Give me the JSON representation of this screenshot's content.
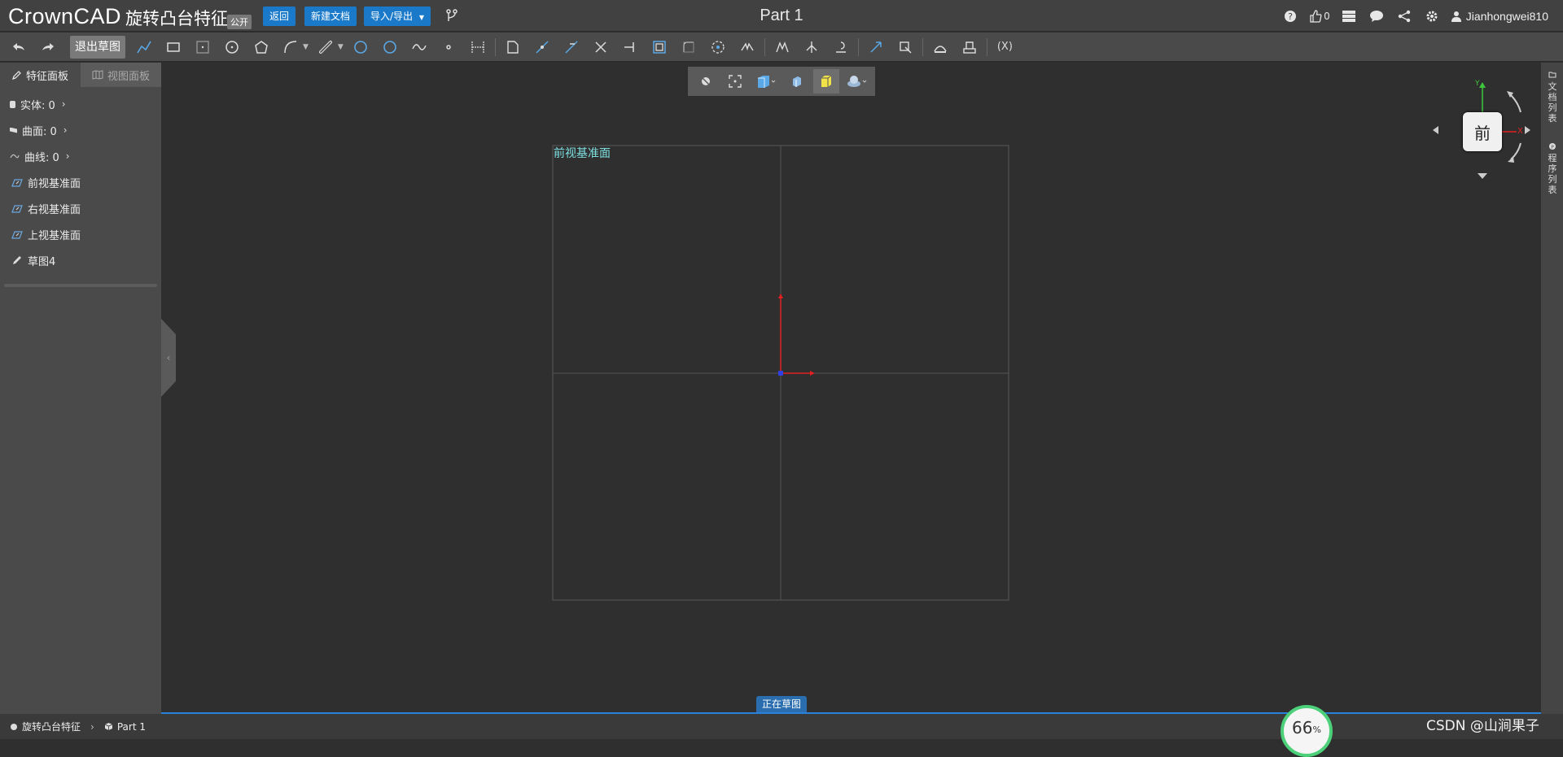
{
  "app": {
    "logo": "CrownCAD",
    "doc_title": "旋转凸台特征",
    "public_tag": "公开",
    "back_label": "返回",
    "new_doc_label": "新建文档",
    "import_export_label": "导入/导出",
    "part_title": "Part 1",
    "like_count": "0",
    "username": "Jianhongwei810"
  },
  "toolbar": {
    "exit_sketch_label": "退出草图",
    "variables_label": "(X)"
  },
  "sidebar": {
    "tabs": [
      {
        "label": "特征面板"
      },
      {
        "label": "视图面板"
      }
    ],
    "counts": [
      {
        "label": "实体: 0"
      },
      {
        "label": "曲面: 0"
      },
      {
        "label": "曲线: 0"
      }
    ],
    "items": [
      {
        "label": "前视基准面"
      },
      {
        "label": "右视基准面"
      },
      {
        "label": "上视基准面"
      },
      {
        "label": "草图4"
      }
    ]
  },
  "right_rail": {
    "doc_list": "文档列表",
    "program_list": "程序列表"
  },
  "viewport": {
    "plane_label": "前视基准面",
    "orient_face": "前",
    "axis_y": "Y",
    "axis_x": "X",
    "sketch_status": "正在草图"
  },
  "statusbar": {
    "crumbs": [
      {
        "label": "旋转凸台特征"
      },
      {
        "label": "Part 1"
      }
    ],
    "progress_value": "66",
    "progress_unit": "%",
    "watermark": "CSDN @山涧果子"
  },
  "colors": {
    "accent": "#1a7ac9",
    "plane_label": "#7ee0e0",
    "axis_x": "#e02020",
    "axis_y": "#3cc83c",
    "progress_ring": "#4cd07a"
  }
}
